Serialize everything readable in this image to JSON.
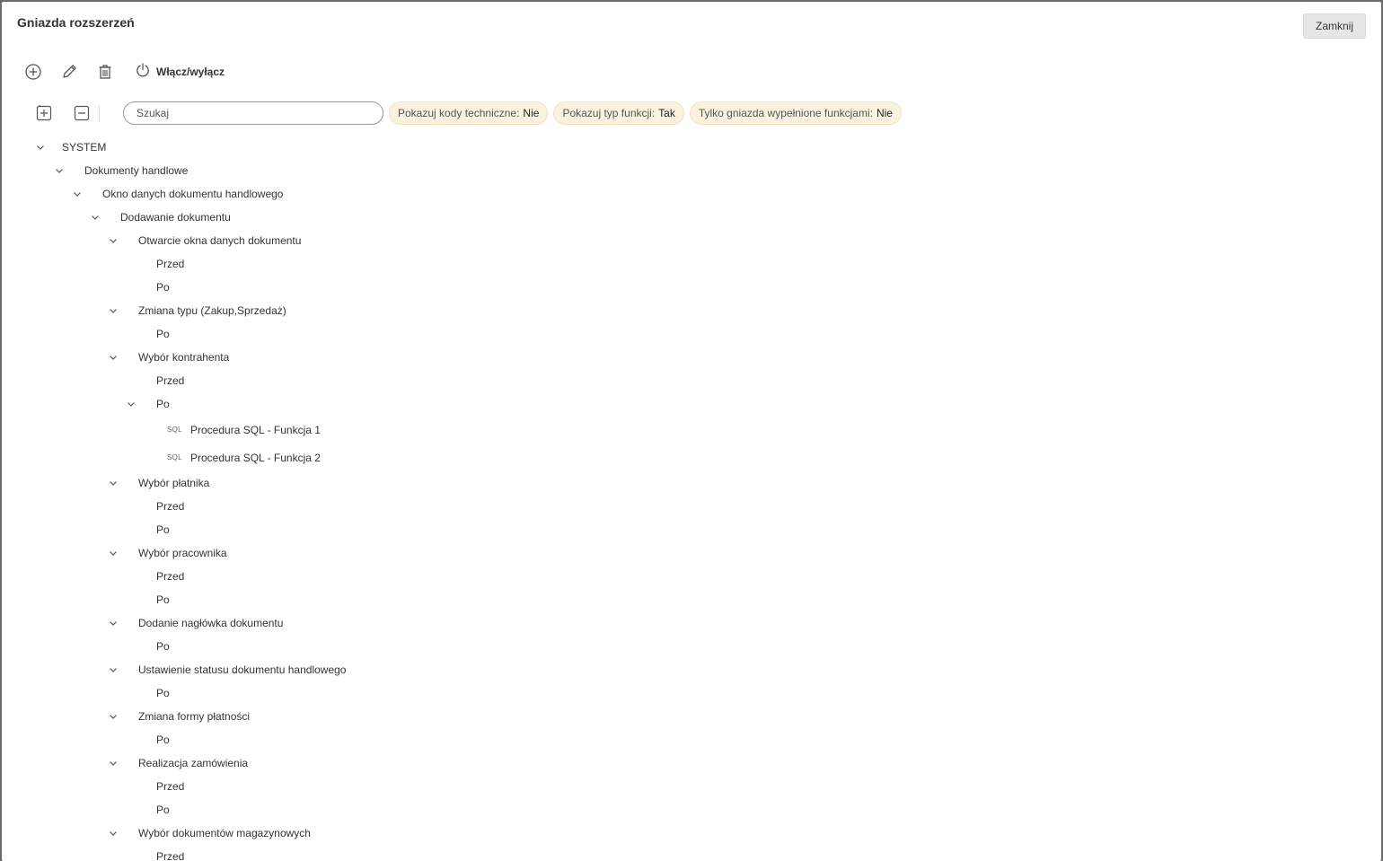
{
  "dialog": {
    "title": "Gniazda rozszerzeń",
    "close_label": "Zamknij"
  },
  "toolbar": {
    "add_icon": "add-circle-icon",
    "edit_icon": "pencil-icon",
    "delete_icon": "trash-icon",
    "toggle_icon": "power-icon",
    "toggle_label": "Włącz/wyłącz"
  },
  "filters": {
    "expand_all_icon": "expand-all-icon",
    "collapse_all_icon": "collapse-all-icon",
    "search_placeholder": "Szukaj",
    "chips": [
      {
        "label": "Pokazuj kody techniczne:",
        "value": "Nie"
      },
      {
        "label": "Pokazuj typ funkcji:",
        "value": "Tak"
      },
      {
        "label": "Tylko gniazda wypełnione funkcjami:",
        "value": "Nie"
      }
    ],
    "chip_color": "#fbf1df"
  },
  "tree": [
    {
      "label": "SYSTEM",
      "level": 0,
      "expanded": true
    },
    {
      "label": "Dokumenty handlowe",
      "level": 1,
      "expanded": true
    },
    {
      "label": "Okno danych dokumentu handlowego",
      "level": 2,
      "expanded": true
    },
    {
      "label": "Dodawanie dokumentu",
      "level": 3,
      "expanded": true
    },
    {
      "label": "Otwarcie okna danych dokumentu",
      "level": 4,
      "expanded": true
    },
    {
      "label": "Przed",
      "level": 5
    },
    {
      "label": "Po",
      "level": 5
    },
    {
      "label": "Zmiana typu (Zakup,Sprzedaż)",
      "level": 4,
      "expanded": true
    },
    {
      "label": "Po",
      "level": 5
    },
    {
      "label": "Wybór kontrahenta",
      "level": 4,
      "expanded": true
    },
    {
      "label": "Przed",
      "level": 5
    },
    {
      "label": "Po",
      "level": 5,
      "expanded": true
    },
    {
      "label": "Procedura SQL - Funkcja 1",
      "level": 6,
      "type": "SQL"
    },
    {
      "label": "Procedura SQL - Funkcja 2",
      "level": 6,
      "type": "SQL"
    },
    {
      "label": "Wybór płatnika",
      "level": 4,
      "expanded": true
    },
    {
      "label": "Przed",
      "level": 5
    },
    {
      "label": "Po",
      "level": 5
    },
    {
      "label": "Wybór pracownika",
      "level": 4,
      "expanded": true
    },
    {
      "label": "Przed",
      "level": 5
    },
    {
      "label": "Po",
      "level": 5
    },
    {
      "label": "Dodanie nagłówka dokumentu",
      "level": 4,
      "expanded": true
    },
    {
      "label": "Po",
      "level": 5
    },
    {
      "label": "Ustawienie statusu dokumentu handlowego",
      "level": 4,
      "expanded": true
    },
    {
      "label": "Po",
      "level": 5
    },
    {
      "label": "Zmiana formy płatności",
      "level": 4,
      "expanded": true
    },
    {
      "label": "Po",
      "level": 5
    },
    {
      "label": "Realizacja zamówienia",
      "level": 4,
      "expanded": true
    },
    {
      "label": "Przed",
      "level": 5
    },
    {
      "label": "Po",
      "level": 5
    },
    {
      "label": "Wybór dokumentów magazynowych",
      "level": 4,
      "expanded": true
    },
    {
      "label": "Przed",
      "level": 5
    }
  ]
}
